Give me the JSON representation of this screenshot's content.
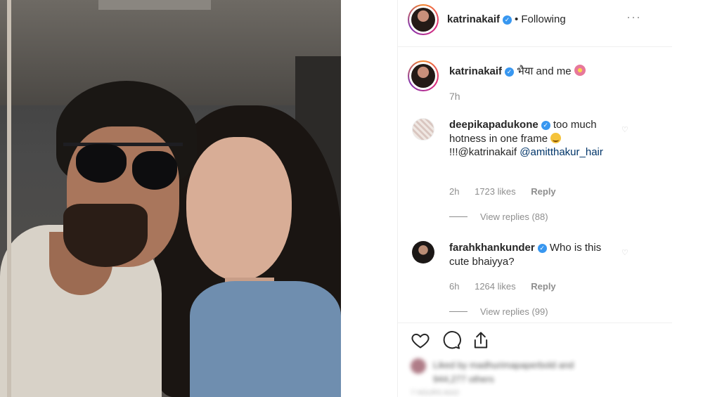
{
  "post": {
    "username": "katrinakaif",
    "follow_status": "Following",
    "more_icon": "more-horizontal-icon"
  },
  "caption": {
    "username": "katrinakaif",
    "text": "भैया and me",
    "time": "7h"
  },
  "comments": [
    {
      "username": "deepikapadukone",
      "text_part1": "too much hotness in one frame",
      "text_part2": "!!!@katrinakaif",
      "mention": "@amitthakur_hair",
      "time": "2h",
      "likes": "1723 likes",
      "reply_label": "Reply",
      "view_replies": "View replies (88)"
    },
    {
      "username": "farahkhankunder",
      "text": "Who is this cute bhaiyya?",
      "time": "6h",
      "likes": "1264 likes",
      "reply_label": "Reply",
      "view_replies": "View replies (99)"
    }
  ],
  "actions": [
    "heart-icon",
    "comment-icon",
    "share-icon"
  ],
  "likes_summary": {
    "line1": "Liked by madhurimapaperbold and",
    "line2": "944,277 others",
    "footer": "7 HOURS AGO"
  },
  "colors": {
    "verified": "#3897f0",
    "text_primary": "#262626",
    "text_secondary": "#8e8e8e",
    "mention": "#003569",
    "divider": "#efefef"
  }
}
